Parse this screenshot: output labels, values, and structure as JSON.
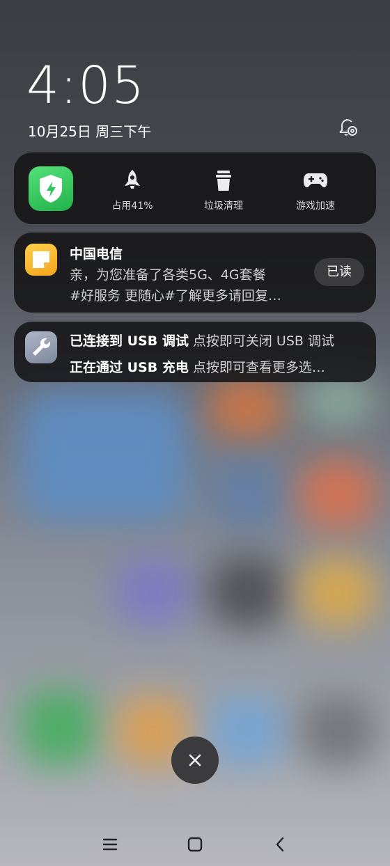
{
  "status": {
    "time": "4:05",
    "date": "10月25日 周三下午"
  },
  "quick_panel": {
    "actions": [
      {
        "icon": "rocket-icon",
        "label": "占用41%"
      },
      {
        "icon": "trash-icon",
        "label": "垃圾清理"
      },
      {
        "icon": "gamepad-icon",
        "label": "游戏加速"
      }
    ]
  },
  "notifications": {
    "telecom": {
      "title": "中国电信",
      "line1": "亲，为您准备了各类5G、4G套餐",
      "line2": "#好服务 更随心#了解更多请回复…",
      "button": "已读"
    },
    "usb": {
      "line1_bold": "已连接到 USB 调试",
      "line1_sub": "点按即可关闭 USB 调试",
      "line2_bold": "正在通过 USB 充电",
      "line2_sub": "点按即可查看更多选…"
    }
  },
  "colors": {
    "accent_green": "#2ec85a",
    "note_yellow": "#f7b324",
    "panel_bg": "#161618"
  }
}
